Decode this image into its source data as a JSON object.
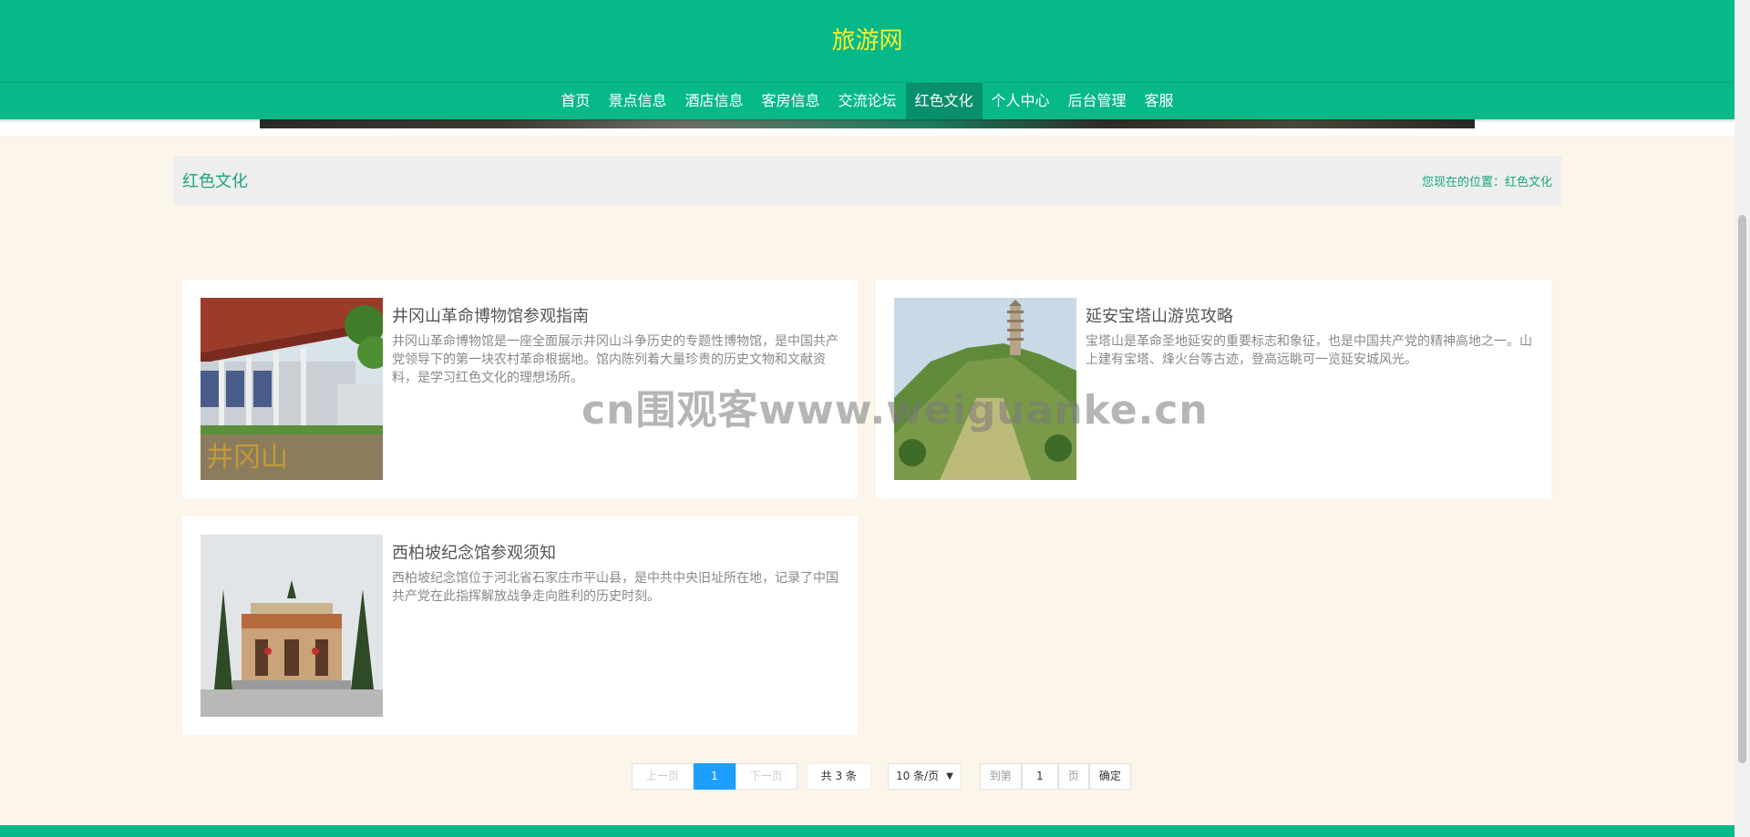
{
  "header": {
    "site_title": "旅游网"
  },
  "nav": {
    "items": [
      {
        "label": "首页"
      },
      {
        "label": "景点信息"
      },
      {
        "label": "酒店信息"
      },
      {
        "label": "客房信息"
      },
      {
        "label": "交流论坛"
      },
      {
        "label": "红色文化",
        "active": true
      },
      {
        "label": "个人中心"
      },
      {
        "label": "后台管理"
      },
      {
        "label": "客服"
      }
    ]
  },
  "breadcrumb": {
    "title": "红色文化",
    "location_prefix": "您现在的位置：",
    "location_current": "红色文化"
  },
  "articles": [
    {
      "title": "井冈山革命博物馆参观指南",
      "description": "井冈山革命博物馆是一座全面展示井冈山斗争历史的专题性博物馆，是中国共产党领导下的第一块农村革命根据地。馆内陈列着大量珍贵的历史文物和文献资料，是学习红色文化的理想场所。",
      "image_caption": "井冈山"
    },
    {
      "title": "延安宝塔山游览攻略",
      "description": "宝塔山是革命圣地延安的重要标志和象征，也是中国共产党的精神高地之一。山上建有宝塔、烽火台等古迹，登高远眺可一览延安城风光。"
    },
    {
      "title": "西柏坡纪念馆参观须知",
      "description": "西柏坡纪念馆位于河北省石家庄市平山县，是中共中央旧址所在地，记录了中国共产党在此指挥解放战争走向胜利的历史时刻。"
    }
  ],
  "pagination": {
    "prev": "上一页",
    "current": "1",
    "next": "下一页",
    "total": "共 3 条",
    "page_size": "10 条/页",
    "goto_prefix": "到第",
    "goto_value": "1",
    "goto_suffix": "页",
    "confirm": "确定"
  },
  "watermark": "cn围观客www.weiguanke.cn",
  "colors": {
    "primary": "#07b889",
    "title_yellow": "#f4f12f",
    "active_nav": "#07906b",
    "page_bg": "#fbf5ea"
  }
}
